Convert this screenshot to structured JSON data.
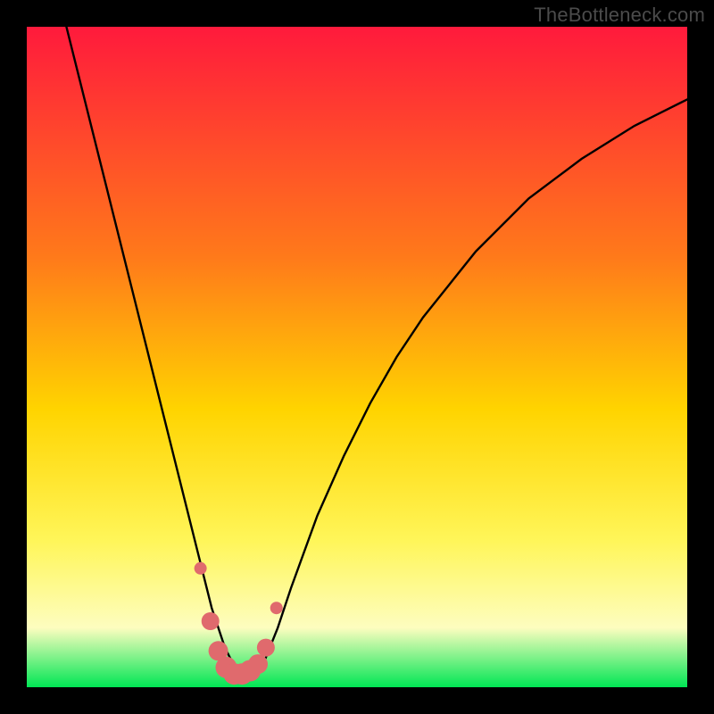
{
  "watermark": "TheBottleneck.com",
  "colors": {
    "background_black": "#000000",
    "gradient_top": "#ff1a3c",
    "gradient_mid1": "#ff7a1a",
    "gradient_mid2": "#ffd400",
    "gradient_mid3": "#fff65a",
    "gradient_pale": "#fdfdbf",
    "gradient_bottom": "#00e654",
    "curve": "#000000",
    "marker_fill": "#e06a6d",
    "marker_stroke": "#d85a5d"
  },
  "chart_data": {
    "type": "line",
    "title": "",
    "xlabel": "",
    "ylabel": "",
    "xlim": [
      0,
      100
    ],
    "ylim": [
      0,
      100
    ],
    "series": [
      {
        "name": "bottleneck-curve",
        "x": [
          6,
          8,
          10,
          12,
          14,
          16,
          18,
          20,
          22,
          24,
          26,
          28,
          29,
          30,
          31,
          32,
          33,
          34,
          35,
          36,
          38,
          40,
          44,
          48,
          52,
          56,
          60,
          64,
          68,
          72,
          76,
          80,
          84,
          88,
          92,
          96,
          100
        ],
        "y": [
          100,
          92,
          84,
          76,
          68,
          60,
          52,
          44,
          36,
          28,
          20,
          12,
          9,
          6,
          4,
          2.5,
          2,
          2,
          2.5,
          4,
          9,
          15,
          26,
          35,
          43,
          50,
          56,
          61,
          66,
          70,
          74,
          77,
          80,
          82.5,
          85,
          87,
          89
        ]
      }
    ],
    "markers": {
      "name": "highlight-dots",
      "x": [
        26.3,
        27.8,
        29.0,
        30.2,
        31.4,
        32.6,
        33.8,
        35.0,
        36.2,
        37.8
      ],
      "y": [
        18.0,
        10.0,
        5.5,
        3.0,
        2.0,
        2.0,
        2.5,
        3.5,
        6.0,
        12.0
      ],
      "r": [
        7,
        10,
        11,
        12,
        12,
        12,
        12,
        11,
        10,
        7
      ]
    }
  }
}
